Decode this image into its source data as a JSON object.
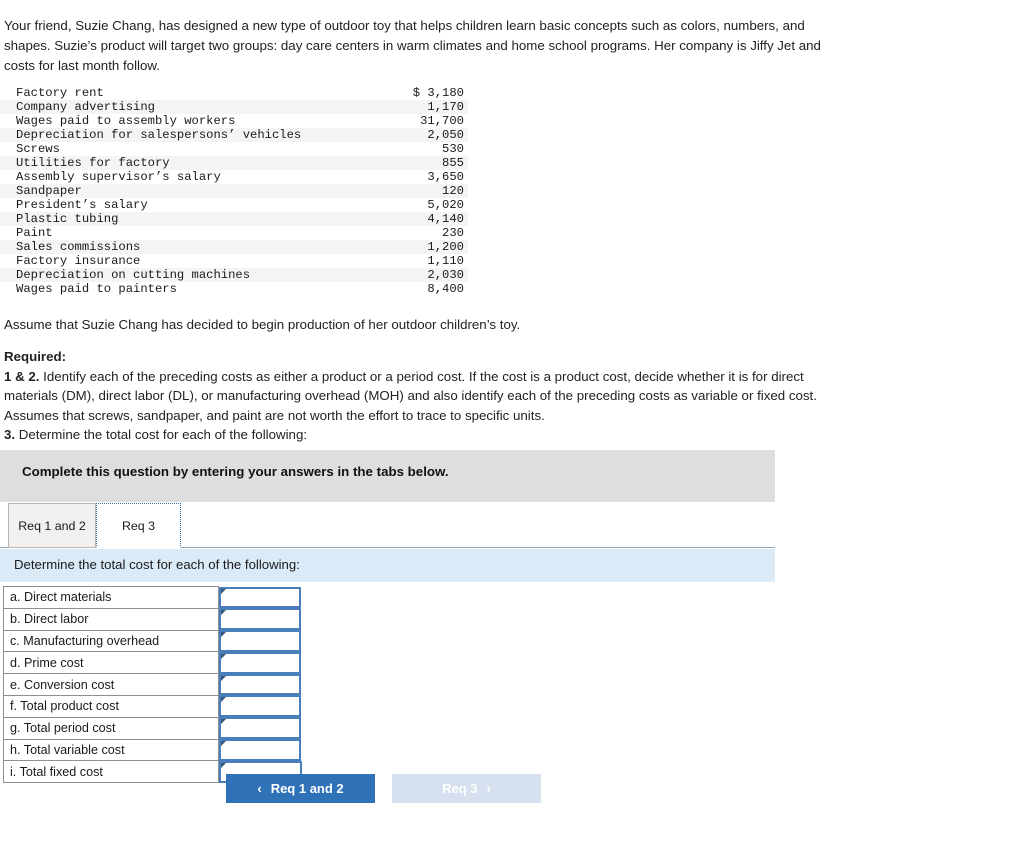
{
  "intro": {
    "paragraph": "Your friend, Suzie Chang, has designed a new type of outdoor toy that helps children learn basic concepts such as colors, numbers, and shapes. Suzie’s product will target two groups: day care centers in warm climates and home school programs. Her company is Jiffy Jet and costs for last month follow."
  },
  "cost_table": {
    "rows": [
      {
        "label": "Factory rent",
        "amount": "$ 3,180"
      },
      {
        "label": "Company advertising",
        "amount": "1,170"
      },
      {
        "label": "Wages paid to assembly workers",
        "amount": "31,700"
      },
      {
        "label": "Depreciation for salespersons’ vehicles",
        "amount": "2,050"
      },
      {
        "label": "Screws",
        "amount": "530"
      },
      {
        "label": "Utilities for factory",
        "amount": "855"
      },
      {
        "label": "Assembly supervisor’s salary",
        "amount": "3,650"
      },
      {
        "label": "Sandpaper",
        "amount": "120"
      },
      {
        "label": "President’s salary",
        "amount": "5,020"
      },
      {
        "label": "Plastic tubing",
        "amount": "4,140"
      },
      {
        "label": "Paint",
        "amount": "230"
      },
      {
        "label": "Sales commissions",
        "amount": "1,200"
      },
      {
        "label": "Factory insurance",
        "amount": "1,110"
      },
      {
        "label": "Depreciation on cutting machines",
        "amount": "2,030"
      },
      {
        "label": "Wages paid to painters",
        "amount": "8,400"
      }
    ]
  },
  "assume_line": "Assume that Suzie Chang has decided to begin production of her outdoor children’s toy.",
  "required": {
    "heading": "Required:",
    "item_1_2_num": "1 & 2.",
    "item_1_2_text": " Identify each of the preceding costs as either a product or a period cost. If the cost is a product cost, decide whether it is for direct materials (DM), direct labor (DL), or manufacturing overhead (MOH) and also identify each of the preceding costs as variable or fixed cost. Assumes that screws, sandpaper, and paint are not worth the effort to trace to specific units.",
    "item_3_num": "3.",
    "item_3_text": " Determine the total cost for each of the following:"
  },
  "gray_banner": {
    "text": "Complete this question by entering your answers in the tabs below."
  },
  "tabs": [
    {
      "label": "Req 1 and 2",
      "active": false
    },
    {
      "label": "Req 3",
      "active": true
    }
  ],
  "blue_banner": {
    "text": "Determine the total cost for each of the following:"
  },
  "answer_table": {
    "rows": [
      {
        "label": "a. Direct materials",
        "value": ""
      },
      {
        "label": "b. Direct labor",
        "value": ""
      },
      {
        "label": "c. Manufacturing overhead",
        "value": ""
      },
      {
        "label": "d. Prime cost",
        "value": ""
      },
      {
        "label": "e. Conversion cost",
        "value": ""
      },
      {
        "label": "f. Total product cost",
        "value": ""
      },
      {
        "label": "g. Total period cost",
        "value": ""
      },
      {
        "label": "h. Total variable cost",
        "value": ""
      },
      {
        "label": "i. Total fixed cost",
        "value": ""
      }
    ]
  },
  "nav": {
    "prev_label": "Req 1 and 2",
    "prev_icon": "chevron-left-icon",
    "next_label": "Req 3",
    "next_icon": "chevron-right-icon",
    "prev_chevron": "‹",
    "next_chevron": "›"
  },
  "colors": {
    "primary_blue": "#2f72b8",
    "disabled_blue": "#d6e0ee",
    "banner_gray": "#dedede",
    "banner_blue": "#dbeaf7",
    "input_border": "#4a7ebb"
  }
}
